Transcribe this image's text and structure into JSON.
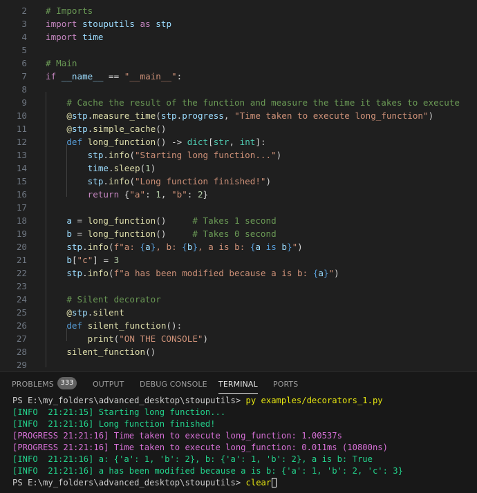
{
  "editor": {
    "lines": [
      {
        "n": "2",
        "t": [
          [
            "# Imports",
            "cmt"
          ]
        ]
      },
      {
        "n": "3",
        "t": [
          [
            "import",
            "kw"
          ],
          [
            " ",
            ""
          ],
          [
            "stouputils",
            "id"
          ],
          [
            " ",
            ""
          ],
          [
            "as",
            "kw"
          ],
          [
            " ",
            ""
          ],
          [
            "stp",
            "id"
          ]
        ]
      },
      {
        "n": "4",
        "t": [
          [
            "import",
            "kw"
          ],
          [
            " ",
            ""
          ],
          [
            "time",
            "id"
          ]
        ]
      },
      {
        "n": "5",
        "t": []
      },
      {
        "n": "6",
        "t": [
          [
            "# Main",
            "cmt"
          ]
        ]
      },
      {
        "n": "7",
        "t": [
          [
            "if",
            "kw"
          ],
          [
            " ",
            ""
          ],
          [
            "__name__",
            "id"
          ],
          [
            " == ",
            "op"
          ],
          [
            "\"__main__\"",
            "str"
          ],
          [
            ":",
            "op"
          ]
        ]
      },
      {
        "n": "8",
        "t": []
      },
      {
        "n": "9",
        "t": [
          [
            "    # Cache the result of the function and measure the time it takes to execute",
            "cmt"
          ]
        ]
      },
      {
        "n": "10",
        "t": [
          [
            "    ",
            ""
          ],
          [
            "@",
            "fn"
          ],
          [
            "stp",
            "id"
          ],
          [
            ".",
            "op"
          ],
          [
            "measure_time",
            "fn"
          ],
          [
            "(",
            "op"
          ],
          [
            "stp",
            "id"
          ],
          [
            ".",
            "op"
          ],
          [
            "progress",
            "id"
          ],
          [
            ", ",
            "op"
          ],
          [
            "\"Time taken to execute long_function\"",
            "str"
          ],
          [
            ")",
            "op"
          ]
        ]
      },
      {
        "n": "11",
        "t": [
          [
            "    ",
            ""
          ],
          [
            "@",
            "fn"
          ],
          [
            "stp",
            "id"
          ],
          [
            ".",
            "op"
          ],
          [
            "simple_cache",
            "fn"
          ],
          [
            "()",
            "op"
          ]
        ]
      },
      {
        "n": "12",
        "t": [
          [
            "    ",
            ""
          ],
          [
            "def",
            "dkw"
          ],
          [
            " ",
            ""
          ],
          [
            "long_function",
            "fn"
          ],
          [
            "() -> ",
            "op"
          ],
          [
            "dict",
            "type"
          ],
          [
            "[",
            "op"
          ],
          [
            "str",
            "type"
          ],
          [
            ", ",
            "op"
          ],
          [
            "int",
            "type"
          ],
          [
            "]:",
            "op"
          ]
        ]
      },
      {
        "n": "13",
        "t": [
          [
            "        ",
            ""
          ],
          [
            "stp",
            "id"
          ],
          [
            ".",
            "op"
          ],
          [
            "info",
            "fn"
          ],
          [
            "(",
            "op"
          ],
          [
            "\"Starting long function...\"",
            "str"
          ],
          [
            ")",
            "op"
          ]
        ]
      },
      {
        "n": "14",
        "t": [
          [
            "        ",
            ""
          ],
          [
            "time",
            "id"
          ],
          [
            ".",
            "op"
          ],
          [
            "sleep",
            "fn"
          ],
          [
            "(",
            "op"
          ],
          [
            "1",
            "num"
          ],
          [
            ")",
            "op"
          ]
        ]
      },
      {
        "n": "15",
        "t": [
          [
            "        ",
            ""
          ],
          [
            "stp",
            "id"
          ],
          [
            ".",
            "op"
          ],
          [
            "info",
            "fn"
          ],
          [
            "(",
            "op"
          ],
          [
            "\"Long function finished!\"",
            "str"
          ],
          [
            ")",
            "op"
          ]
        ]
      },
      {
        "n": "16",
        "t": [
          [
            "        ",
            ""
          ],
          [
            "return",
            "kw"
          ],
          [
            " {",
            "op"
          ],
          [
            "\"a\"",
            "str"
          ],
          [
            ": ",
            "op"
          ],
          [
            "1",
            "num"
          ],
          [
            ", ",
            "op"
          ],
          [
            "\"b\"",
            "str"
          ],
          [
            ": ",
            "op"
          ],
          [
            "2",
            "num"
          ],
          [
            "}",
            "op"
          ]
        ]
      },
      {
        "n": "17",
        "t": []
      },
      {
        "n": "18",
        "t": [
          [
            "    ",
            ""
          ],
          [
            "a",
            "id"
          ],
          [
            " = ",
            "op"
          ],
          [
            "long_function",
            "fn"
          ],
          [
            "()",
            "op"
          ],
          [
            "     ",
            ""
          ],
          [
            "# Takes 1 second",
            "cmt"
          ]
        ]
      },
      {
        "n": "19",
        "t": [
          [
            "    ",
            ""
          ],
          [
            "b",
            "id"
          ],
          [
            " = ",
            "op"
          ],
          [
            "long_function",
            "fn"
          ],
          [
            "()",
            "op"
          ],
          [
            "     ",
            ""
          ],
          [
            "# Takes 0 second",
            "cmt"
          ]
        ]
      },
      {
        "n": "20",
        "t": [
          [
            "    ",
            ""
          ],
          [
            "stp",
            "id"
          ],
          [
            ".",
            "op"
          ],
          [
            "info",
            "fn"
          ],
          [
            "(",
            "op"
          ],
          [
            "f\"a: ",
            "str"
          ],
          [
            "{",
            "dkw"
          ],
          [
            "a",
            "id"
          ],
          [
            "}",
            "dkw"
          ],
          [
            ", b: ",
            "str"
          ],
          [
            "{",
            "dkw"
          ],
          [
            "b",
            "id"
          ],
          [
            "}",
            "dkw"
          ],
          [
            ", a is b: ",
            "str"
          ],
          [
            "{",
            "dkw"
          ],
          [
            "a",
            "id"
          ],
          [
            " is ",
            "dkw"
          ],
          [
            "b",
            "id"
          ],
          [
            "}",
            "dkw"
          ],
          [
            "\"",
            "str"
          ],
          [
            ")",
            "op"
          ]
        ]
      },
      {
        "n": "21",
        "t": [
          [
            "    ",
            ""
          ],
          [
            "b",
            "id"
          ],
          [
            "[",
            "op"
          ],
          [
            "\"c\"",
            "str"
          ],
          [
            "] = ",
            "op"
          ],
          [
            "3",
            "num"
          ]
        ]
      },
      {
        "n": "22",
        "t": [
          [
            "    ",
            ""
          ],
          [
            "stp",
            "id"
          ],
          [
            ".",
            "op"
          ],
          [
            "info",
            "fn"
          ],
          [
            "(",
            "op"
          ],
          [
            "f\"a has been modified because a is b: ",
            "str"
          ],
          [
            "{",
            "dkw"
          ],
          [
            "a",
            "id"
          ],
          [
            "}",
            "dkw"
          ],
          [
            "\"",
            "str"
          ],
          [
            ")",
            "op"
          ]
        ]
      },
      {
        "n": "23",
        "t": []
      },
      {
        "n": "24",
        "t": [
          [
            "    # Silent decorator",
            "cmt"
          ]
        ]
      },
      {
        "n": "25",
        "t": [
          [
            "    ",
            ""
          ],
          [
            "@",
            "fn"
          ],
          [
            "stp",
            "id"
          ],
          [
            ".",
            "op"
          ],
          [
            "silent",
            "fn"
          ]
        ]
      },
      {
        "n": "26",
        "t": [
          [
            "    ",
            ""
          ],
          [
            "def",
            "dkw"
          ],
          [
            " ",
            ""
          ],
          [
            "silent_function",
            "fn"
          ],
          [
            "():",
            "op"
          ]
        ]
      },
      {
        "n": "27",
        "t": [
          [
            "        ",
            ""
          ],
          [
            "print",
            "fn"
          ],
          [
            "(",
            "op"
          ],
          [
            "\"ON THE CONSOLE\"",
            "str"
          ],
          [
            ")",
            "op"
          ]
        ]
      },
      {
        "n": "28",
        "t": [
          [
            "    ",
            ""
          ],
          [
            "silent_function",
            "fn"
          ],
          [
            "()",
            "op"
          ]
        ]
      },
      {
        "n": "29",
        "t": []
      }
    ]
  },
  "panel": {
    "tabs": {
      "problems": "PROBLEMS",
      "problems_count": "333",
      "output": "OUTPUT",
      "debug_console": "DEBUG CONSOLE",
      "terminal": "TERMINAL",
      "ports": "PORTS"
    },
    "active_tab": "TERMINAL"
  },
  "terminal": {
    "prompt": "PS E:\\my_folders\\advanced_desktop\\stouputils> ",
    "command1": "py examples/decorators_1.py",
    "output": [
      {
        "kind": "info",
        "text": "[INFO  21:21:15] Starting long function..."
      },
      {
        "kind": "info",
        "text": "[INFO  21:21:16] Long function finished!"
      },
      {
        "kind": "progress",
        "text": "[PROGRESS 21:21:16] Time taken to execute long_function: 1.00537s"
      },
      {
        "kind": "progress",
        "text": "[PROGRESS 21:21:16] Time taken to execute long_function: 0.011ms (10800ns)"
      },
      {
        "kind": "info",
        "text": "[INFO  21:21:16] a: {'a': 1, 'b': 2}, b: {'a': 1, 'b': 2}, a is b: True"
      },
      {
        "kind": "info",
        "text": "[INFO  21:21:16] a has been modified because a is b: {'a': 1, 'b': 2, 'c': 3}"
      }
    ],
    "command2": "clear"
  },
  "colors": {
    "editor_bg": "#1f1f1f",
    "panel_bg": "#181818",
    "keyword": "#c586c0",
    "def_keyword": "#569cd6",
    "identifier": "#9cdcfe",
    "function": "#dcdcaa",
    "string": "#ce9178",
    "number": "#b5cea8",
    "comment": "#6a9955",
    "type": "#4ec9b0",
    "terminal_info": "#23d18b",
    "terminal_progress": "#d670d6",
    "terminal_command": "#e5e510"
  }
}
